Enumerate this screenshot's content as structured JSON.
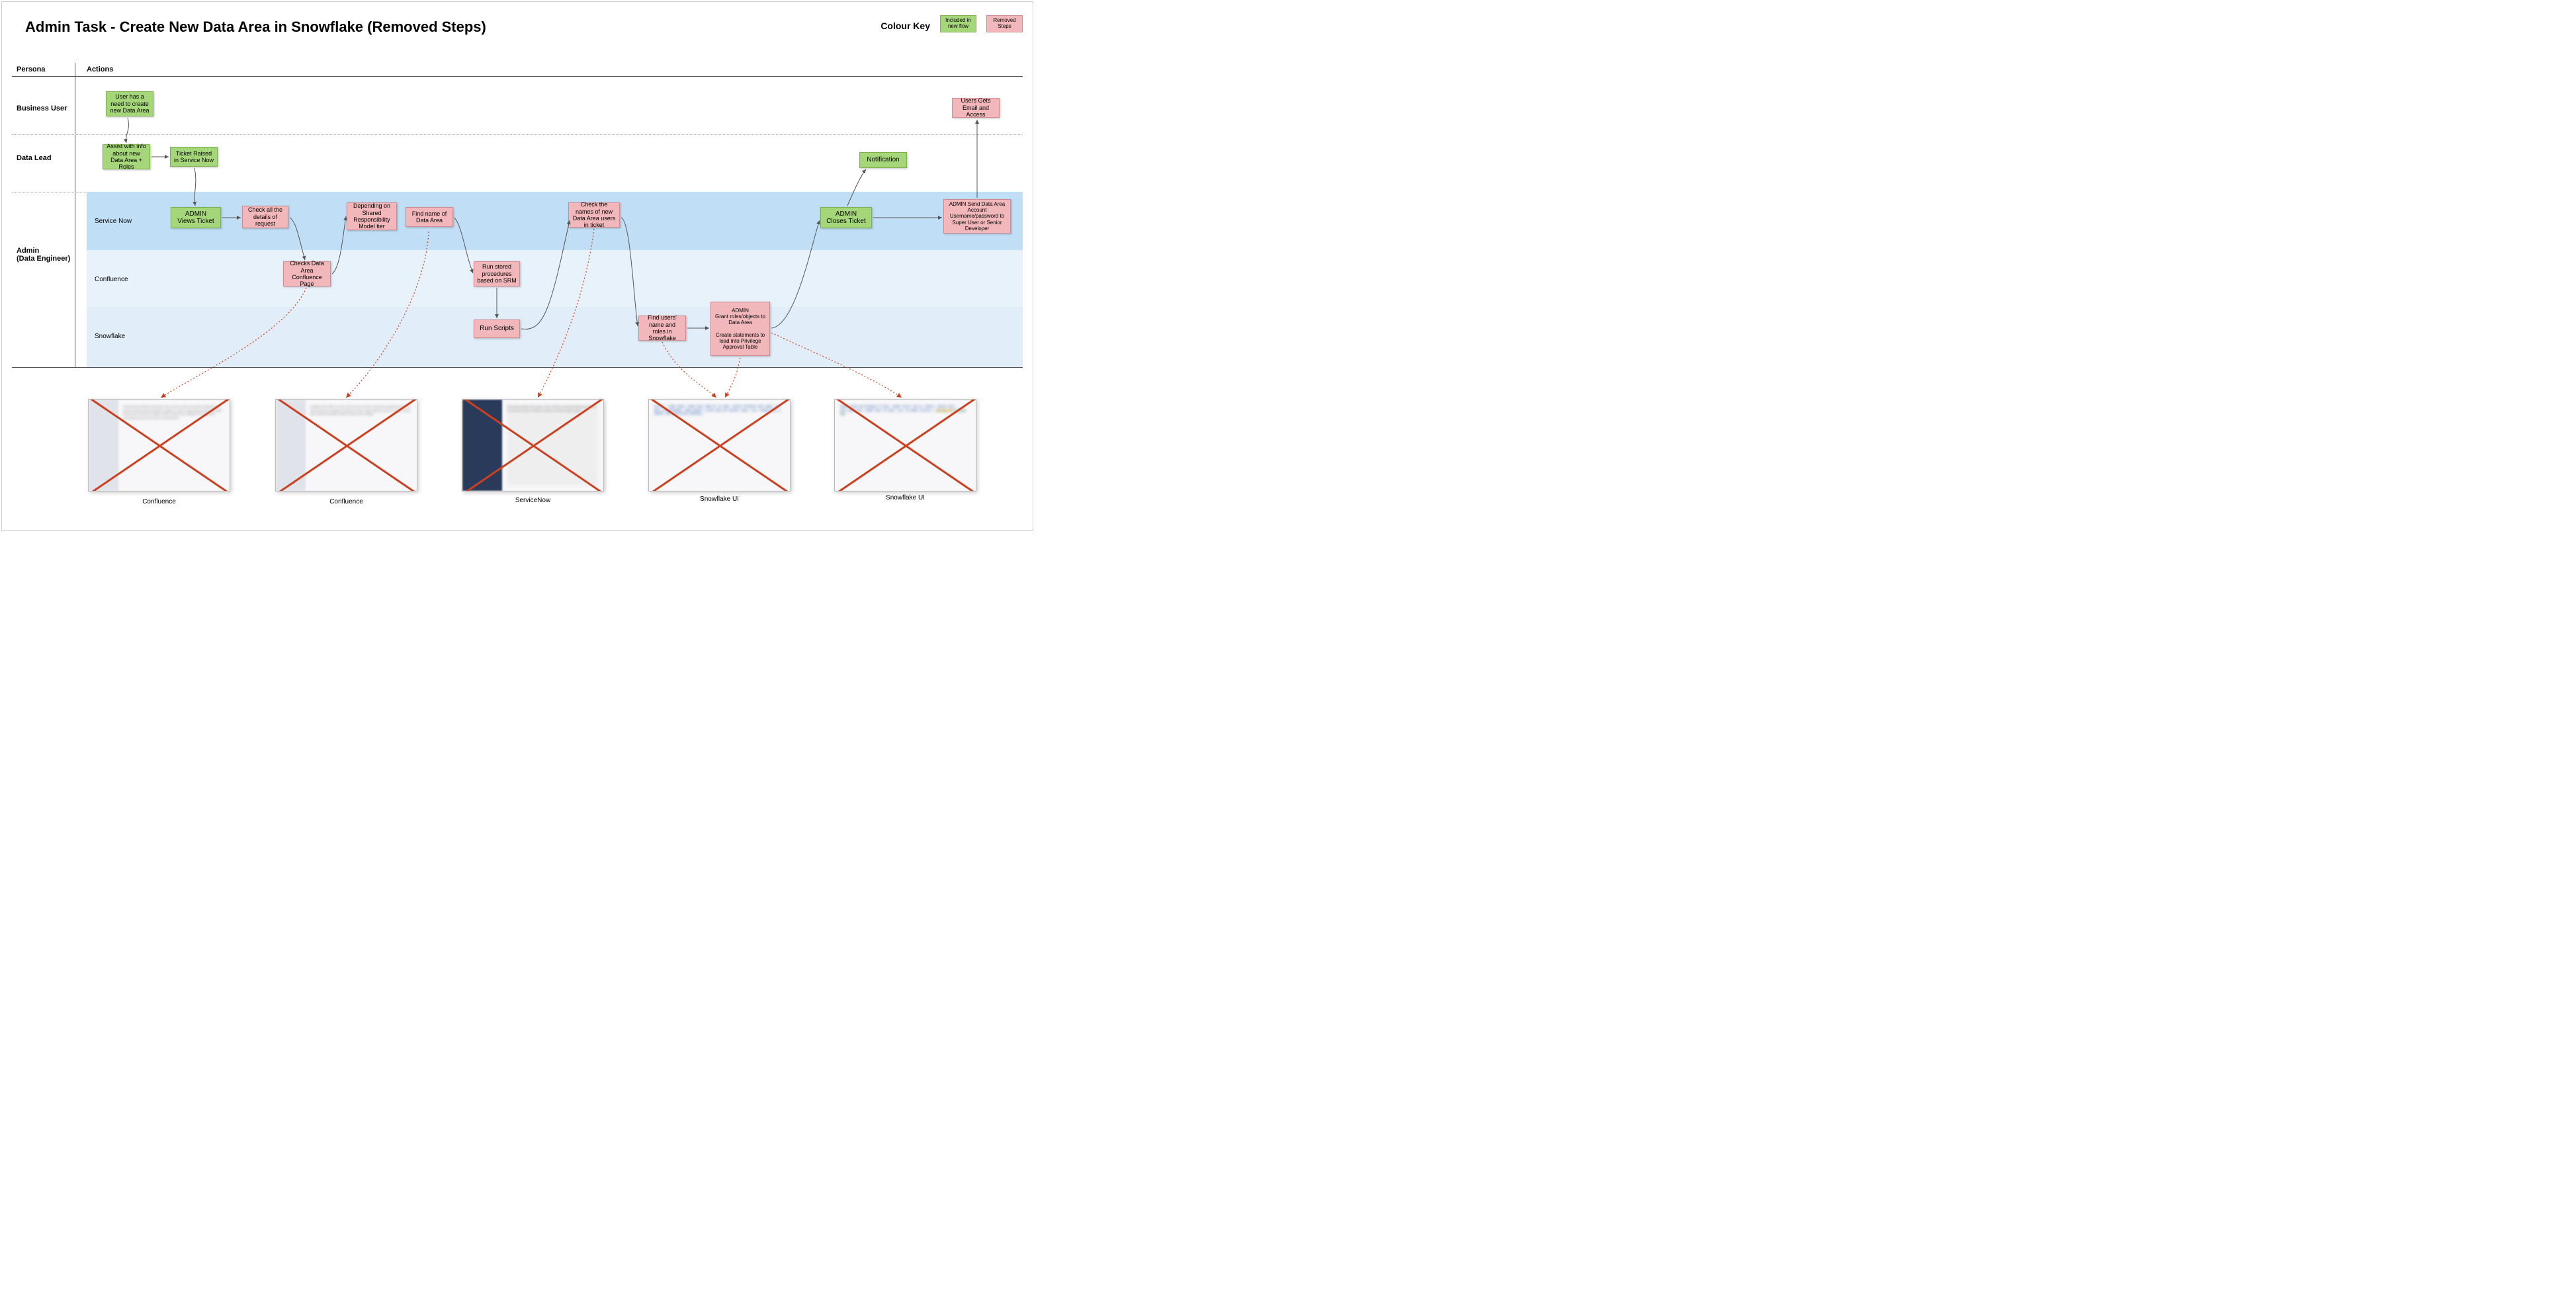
{
  "title": "Admin Task - Create New Data Area in Snowflake (Removed Steps)",
  "colour_key": {
    "label": "Colour Key",
    "included": "Included in new flow",
    "removed": "Removed Steps"
  },
  "columns": {
    "persona": "Persona",
    "actions": "Actions"
  },
  "rows": {
    "business_user": "Business User",
    "data_lead": "Data Lead",
    "admin": "Admin\n(Data Engineer)"
  },
  "lanes": {
    "service_now": "Service Now",
    "confluence": "Confluence",
    "snowflake": "Snowflake"
  },
  "notes": {
    "bu_need": "User has a need to create new Data Area",
    "dl_assist": "Assist with info about new Data Area + Roles",
    "dl_ticket": "Ticket Raised in Service Now",
    "sn_views": "ADMIN\nViews Ticket",
    "sn_check_details": "Check all the details of request",
    "sn_srm": "Depending on Shared Responsibility Model tier",
    "sn_find_name": "Find name of Data Area",
    "sn_check_users": "Check the  names of new Data Area users in ticket",
    "sn_closes": "ADMIN\nCloses Ticket",
    "sn_send_creds": "ADMIN\nSend Data Area Account Username/password to Super User or Senior Developer",
    "conf_check_page": "Checks Data Area Confluence Page",
    "conf_run_sp": "Run  stored procedures based on SRM",
    "sf_run_scripts": "Run Scripts",
    "sf_find_users": "Find users' name and roles in Snowflake",
    "sf_grant": "ADMIN\nGrant roles/objects to Data Area\n\nCreate statements to load into Privilege Approval Table",
    "dl_notification": "Notification",
    "bu_email": "Users Gets Email and Access"
  },
  "screenshots": {
    "s1": "Confluence",
    "s2": "Confluence",
    "s3": "ServiceNow",
    "s4": "Snowflake UI",
    "s5": "Snowflake UI"
  }
}
